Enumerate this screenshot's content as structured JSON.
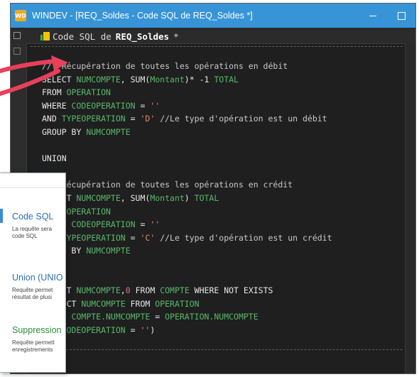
{
  "window": {
    "title": "WINDEV - [REQ_Soldes - Code SQL de REQ_Soldes *]",
    "app_icon_text": "WD"
  },
  "tab": {
    "prefix": "Code SQL de",
    "name": "REQ_Soldes",
    "modified": "*"
  },
  "code_lines": [
    [
      {
        "t": "//  Récupération de toutes les opérations en débit",
        "c": "cmt"
      }
    ],
    [
      {
        "t": "SELECT ",
        "c": "kw"
      },
      {
        "t": "NUMCOMPTE",
        "c": "grn"
      },
      {
        "t": ", SUM(",
        "c": "kw"
      },
      {
        "t": "Montant",
        "c": "grn"
      },
      {
        "t": ")* -1 ",
        "c": "kw"
      },
      {
        "t": "TOTAL",
        "c": "grn"
      }
    ],
    [
      {
        "t": "FROM ",
        "c": "kw"
      },
      {
        "t": "OPERATION",
        "c": "grn"
      }
    ],
    [
      {
        "t": "WHERE ",
        "c": "kw"
      },
      {
        "t": "CODEOPERATION",
        "c": "grn"
      },
      {
        "t": " = ",
        "c": "kw"
      },
      {
        "t": "''",
        "c": "str"
      }
    ],
    [
      {
        "t": "AND ",
        "c": "kw"
      },
      {
        "t": "TYPEOPERATION",
        "c": "grn"
      },
      {
        "t": " = ",
        "c": "kw"
      },
      {
        "t": "'D'",
        "c": "str"
      },
      {
        "t": " //Le type d'opération est un débit",
        "c": "cmt"
      }
    ],
    [
      {
        "t": "GROUP BY ",
        "c": "kw"
      },
      {
        "t": "NUMCOMPTE",
        "c": "grn"
      }
    ],
    [],
    [
      {
        "t": "UNION",
        "c": "kw"
      }
    ],
    [],
    [
      {
        "t": "//  Récupération de toutes les opérations en crédit",
        "c": "cmt"
      }
    ],
    [
      {
        "t": "SELECT ",
        "c": "kw"
      },
      {
        "t": "NUMCOMPTE",
        "c": "grn"
      },
      {
        "t": ", SUM(",
        "c": "kw"
      },
      {
        "t": "Montant",
        "c": "grn"
      },
      {
        "t": ") ",
        "c": "kw"
      },
      {
        "t": "TOTAL",
        "c": "grn"
      }
    ],
    [
      {
        "t": "FROM ",
        "c": "kw"
      },
      {
        "t": "OPERATION",
        "c": "grn"
      }
    ],
    [
      {
        "t": "WHERE ",
        "c": "kw"
      },
      {
        "t": "CODEOPERATION",
        "c": "grn"
      },
      {
        "t": " = ",
        "c": "kw"
      },
      {
        "t": "''",
        "c": "str"
      }
    ],
    [
      {
        "t": "AND ",
        "c": "kw"
      },
      {
        "t": "TYPEOPERATION",
        "c": "grn"
      },
      {
        "t": " = ",
        "c": "kw"
      },
      {
        "t": "'C'",
        "c": "str"
      },
      {
        "t": " //Le type d'opération est un crédit",
        "c": "cmt"
      }
    ],
    [
      {
        "t": "GROUP BY ",
        "c": "kw"
      },
      {
        "t": "NUMCOMPTE",
        "c": "grn"
      }
    ],
    [],
    [],
    [
      {
        "t": "SELECT ",
        "c": "kw"
      },
      {
        "t": "NUMCOMPTE",
        "c": "grn"
      },
      {
        "t": ",",
        "c": "kw"
      },
      {
        "t": "0",
        "c": "num"
      },
      {
        "t": " FROM ",
        "c": "kw"
      },
      {
        "t": "COMPTE",
        "c": "grn"
      },
      {
        "t": " WHERE NOT EXISTS",
        "c": "kw"
      }
    ],
    [
      {
        "t": "(SELECT ",
        "c": "kw"
      },
      {
        "t": "NUMCOMPTE",
        "c": "grn"
      },
      {
        "t": " FROM ",
        "c": "kw"
      },
      {
        "t": "OPERATION",
        "c": "grn"
      }
    ],
    [
      {
        "t": "WHERE ",
        "c": "kw"
      },
      {
        "t": "COMPTE.NUMCOMPTE",
        "c": "grn"
      },
      {
        "t": " = ",
        "c": "kw"
      },
      {
        "t": "OPERATION.NUMCOMPTE",
        "c": "grn"
      }
    ],
    [
      {
        "t": "AND ",
        "c": "kw"
      },
      {
        "t": "CODEOPERATION",
        "c": "grn"
      },
      {
        "t": " = ",
        "c": "kw"
      },
      {
        "t": "''",
        "c": "str"
      },
      {
        "t": ")",
        "c": "kw"
      }
    ]
  ],
  "popup": {
    "items": [
      {
        "title": "Code SQL",
        "desc_lines": [
          "La requête sera",
          "code SQL"
        ],
        "title_color": "#2a6fb5"
      },
      {
        "title": "Union (UNIO",
        "desc_lines": [
          "Requête permet",
          "résultat de plusi"
        ],
        "title_color": "#2a6fb5"
      },
      {
        "title": "Suppression",
        "desc_lines": [
          "Requête permett",
          "enregistrements"
        ],
        "title_color": "#2a8f3a"
      }
    ]
  },
  "colors": {
    "titlebar": "#3794d7",
    "editor_bg": "#1f1f1f",
    "annotation_arrow": "#e8405a"
  }
}
